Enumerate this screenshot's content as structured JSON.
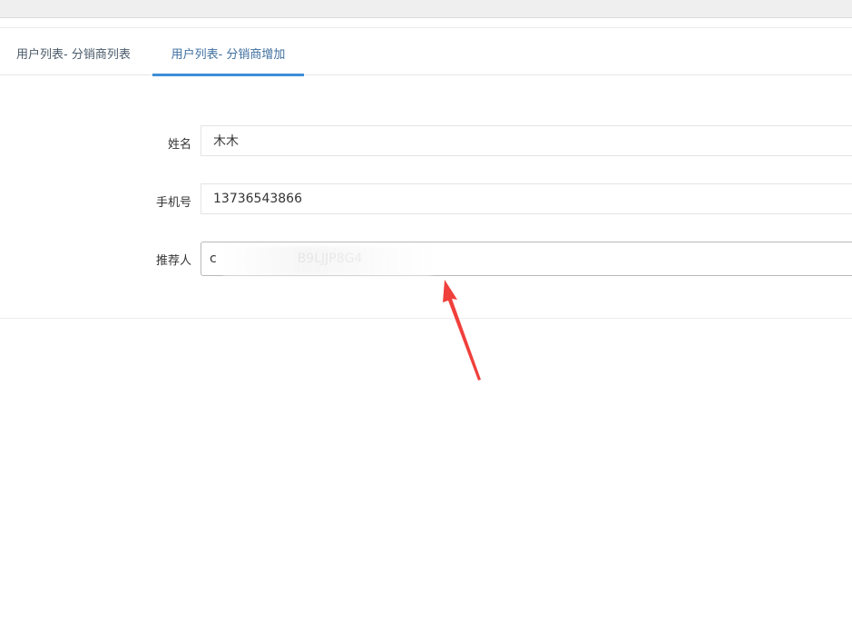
{
  "tabs": {
    "list_label": "用户列表- 分销商列表",
    "add_label": "用户列表- 分销商增加",
    "active": "add"
  },
  "form": {
    "name": {
      "label": "姓名",
      "value": "木木"
    },
    "phone": {
      "label": "手机号",
      "value": "13736543866"
    },
    "referrer": {
      "label": "推荐人",
      "value": "c                    B9LJJP8G4"
    }
  },
  "colors": {
    "active_tab_underline": "#3e8ed8",
    "annotation_arrow": "#f0403c"
  },
  "annotation": {
    "icon": "red-arrow-icon"
  }
}
